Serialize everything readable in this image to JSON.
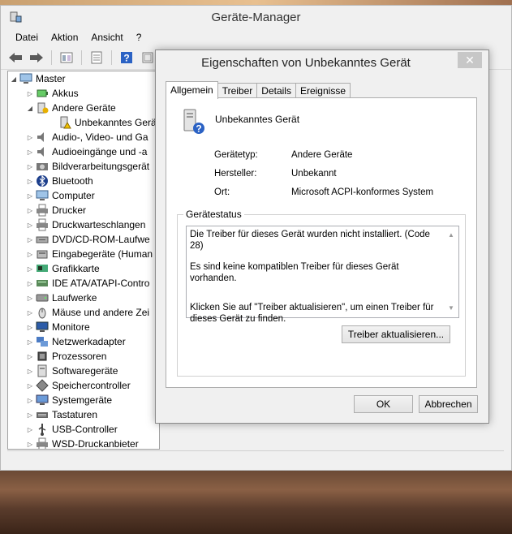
{
  "window": {
    "title": "Geräte-Manager",
    "menu": [
      "Datei",
      "Aktion",
      "Ansicht",
      "?"
    ]
  },
  "toolbar": {
    "icons": [
      "back-icon",
      "forward-icon",
      "properties-icon",
      "view-icon",
      "help-icon",
      "scan-icon"
    ]
  },
  "tree": {
    "root": "Master",
    "items": [
      {
        "label": "Akkus",
        "icon": "battery-icon",
        "indent": 1,
        "expander": "collapsed"
      },
      {
        "label": "Andere Geräte",
        "icon": "other-devices-icon",
        "indent": 1,
        "expander": "expanded"
      },
      {
        "label": "Unbekanntes Gerät",
        "icon": "unknown-device-icon",
        "indent": 2,
        "expander": "none"
      },
      {
        "label": "Audio-, Video- und Ga",
        "icon": "speaker-icon",
        "indent": 1,
        "expander": "collapsed"
      },
      {
        "label": "Audioeingänge und -a",
        "icon": "speaker-icon",
        "indent": 1,
        "expander": "collapsed"
      },
      {
        "label": "Bildverarbeitungsgerät",
        "icon": "camera-icon",
        "indent": 1,
        "expander": "collapsed"
      },
      {
        "label": "Bluetooth",
        "icon": "bluetooth-icon",
        "indent": 1,
        "expander": "collapsed"
      },
      {
        "label": "Computer",
        "icon": "computer-icon",
        "indent": 1,
        "expander": "collapsed"
      },
      {
        "label": "Drucker",
        "icon": "printer-icon",
        "indent": 1,
        "expander": "collapsed"
      },
      {
        "label": "Druckwarteschlangen",
        "icon": "printer-icon",
        "indent": 1,
        "expander": "collapsed"
      },
      {
        "label": "DVD/CD-ROM-Laufwe",
        "icon": "disc-icon",
        "indent": 1,
        "expander": "collapsed"
      },
      {
        "label": "Eingabegeräte (Human",
        "icon": "input-device-icon",
        "indent": 1,
        "expander": "collapsed"
      },
      {
        "label": "Grafikkarte",
        "icon": "display-adapter-icon",
        "indent": 1,
        "expander": "collapsed"
      },
      {
        "label": "IDE ATA/ATAPI-Contro",
        "icon": "ide-icon",
        "indent": 1,
        "expander": "collapsed"
      },
      {
        "label": "Laufwerke",
        "icon": "drive-icon",
        "indent": 1,
        "expander": "collapsed"
      },
      {
        "label": "Mäuse und andere Zei",
        "icon": "mouse-icon",
        "indent": 1,
        "expander": "collapsed"
      },
      {
        "label": "Monitore",
        "icon": "monitor-icon",
        "indent": 1,
        "expander": "collapsed"
      },
      {
        "label": "Netzwerkadapter",
        "icon": "network-icon",
        "indent": 1,
        "expander": "collapsed"
      },
      {
        "label": "Prozessoren",
        "icon": "processor-icon",
        "indent": 1,
        "expander": "collapsed"
      },
      {
        "label": "Softwaregeräte",
        "icon": "software-device-icon",
        "indent": 1,
        "expander": "collapsed"
      },
      {
        "label": "Speichercontroller",
        "icon": "storage-controller-icon",
        "indent": 1,
        "expander": "collapsed"
      },
      {
        "label": "Systemgeräte",
        "icon": "system-device-icon",
        "indent": 1,
        "expander": "collapsed"
      },
      {
        "label": "Tastaturen",
        "icon": "keyboard-icon",
        "indent": 1,
        "expander": "collapsed"
      },
      {
        "label": "USB-Controller",
        "icon": "usb-icon",
        "indent": 1,
        "expander": "collapsed"
      },
      {
        "label": "WSD-Druckanbieter",
        "icon": "printer-icon",
        "indent": 1,
        "expander": "collapsed"
      }
    ]
  },
  "dialog": {
    "title": "Eigenschaften von Unbekanntes Gerät",
    "close_label": "✕",
    "tabs": [
      "Allgemein",
      "Treiber",
      "Details",
      "Ereignisse"
    ],
    "active_tab": "Allgemein",
    "device_name": "Unbekanntes Gerät",
    "properties": [
      {
        "label": "Gerätetyp:",
        "value": "Andere Geräte"
      },
      {
        "label": "Hersteller:",
        "value": "Unbekannt"
      },
      {
        "label": "Ort:",
        "value": "Microsoft ACPI-konformes System"
      }
    ],
    "status_group_label": "Gerätestatus",
    "status_lines": [
      "Die Treiber für dieses Gerät wurden nicht installiert. (Code 28)",
      "Es sind keine kompatiblen Treiber für dieses Gerät vorhanden.",
      "Klicken Sie auf \"Treiber aktualisieren\", um einen Treiber für dieses Gerät zu finden."
    ],
    "update_button": "Treiber aktualisieren...",
    "ok_button": "OK",
    "cancel_button": "Abbrechen"
  }
}
